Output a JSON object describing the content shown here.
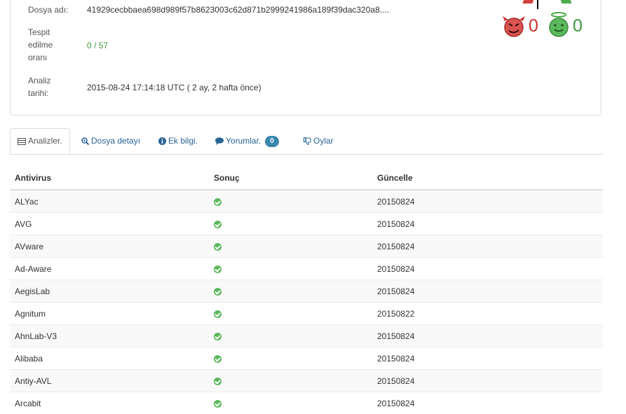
{
  "file_info": {
    "name_label": "Dosya adı:",
    "name_value": "41929cecbbaea698d989f57b8623003c62d871b2999241986a189f39dac320a8....",
    "detection_label_1": "Tespit",
    "detection_label_2": "edilme",
    "detection_label_3": "oranı",
    "detection_value": "0 / 57",
    "date_label_1": "Analiz",
    "date_label_2": "tarihi:",
    "date_value": "2015-08-24 17:14:18 UTC ( 2 ay, 2 hafta önce)"
  },
  "votes": {
    "malicious": "0",
    "harmless": "0",
    "malicious_color": "#c9302c",
    "harmless_color": "#3c9a3c"
  },
  "tabs": [
    {
      "label": "Analizler.",
      "icon": "table-icon",
      "active": true
    },
    {
      "label": "Dosya detayı",
      "icon": "zoom-in-icon"
    },
    {
      "label": "Ek bilgi.",
      "icon": "info-sign-icon"
    },
    {
      "label": "Yorumlar.",
      "icon": "comment-icon",
      "badge": "0"
    },
    {
      "label": "Oylar",
      "icon": "thumbs-down-icon"
    }
  ],
  "table": {
    "headers": [
      "Antivirus",
      "Sonuç",
      "Güncelle"
    ],
    "rows": [
      {
        "antivirus": "ALYac",
        "result": "clean",
        "update": "20150824"
      },
      {
        "antivirus": "AVG",
        "result": "clean",
        "update": "20150824"
      },
      {
        "antivirus": "AVware",
        "result": "clean",
        "update": "20150824"
      },
      {
        "antivirus": "Ad-Aware",
        "result": "clean",
        "update": "20150824"
      },
      {
        "antivirus": "AegisLab",
        "result": "clean",
        "update": "20150824"
      },
      {
        "antivirus": "Agnitum",
        "result": "clean",
        "update": "20150822"
      },
      {
        "antivirus": "AhnLab-V3",
        "result": "clean",
        "update": "20150824"
      },
      {
        "antivirus": "Alibaba",
        "result": "clean",
        "update": "20150824"
      },
      {
        "antivirus": "Antiy-AVL",
        "result": "clean",
        "update": "20150824"
      },
      {
        "antivirus": "Arcabit",
        "result": "clean",
        "update": "20150824"
      }
    ]
  }
}
